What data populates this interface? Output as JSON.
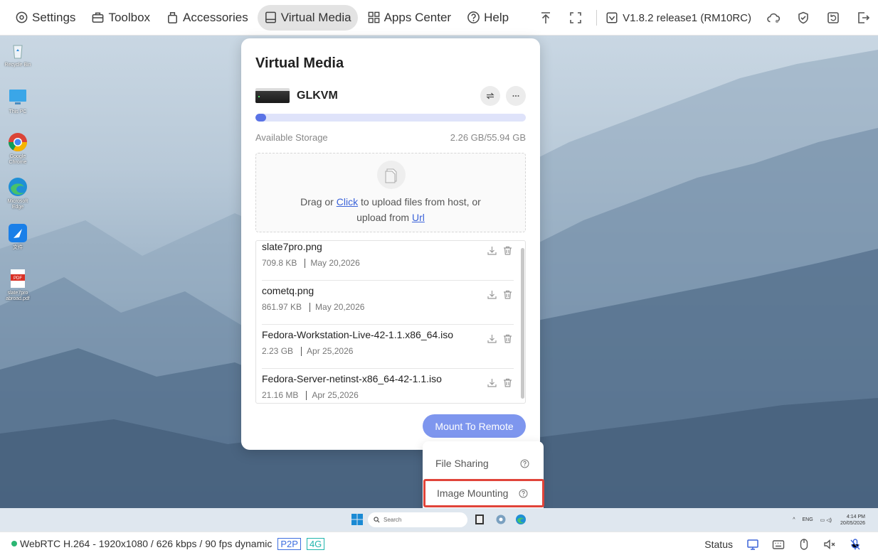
{
  "toolbar": {
    "nav": [
      {
        "label": "Settings",
        "icon": "settings-icon"
      },
      {
        "label": "Toolbox",
        "icon": "toolbox-icon"
      },
      {
        "label": "Accessories",
        "icon": "accessories-icon"
      },
      {
        "label": "Virtual Media",
        "icon": "drive-icon",
        "active": true
      },
      {
        "label": "Apps Center",
        "icon": "apps-icon"
      },
      {
        "label": "Help",
        "icon": "help-icon"
      }
    ],
    "version": "V1.8.2 release1 (RM10RC)"
  },
  "desktop": {
    "icons": [
      {
        "label": "Recycle Bin"
      },
      {
        "label": "This PC"
      },
      {
        "label": "Google Chrome"
      },
      {
        "label": "Microsoft Edge"
      },
      {
        "label": "文件"
      },
      {
        "label": "slate7pro abroad.pdf"
      }
    ]
  },
  "panel": {
    "title": "Virtual Media",
    "device_name": "GLKVM",
    "storage_label": "Available Storage",
    "storage_value": "2.26 GB/55.94 GB",
    "storage_fraction": 0.04,
    "upload_text_1": "Drag or ",
    "upload_link_click": "Click",
    "upload_text_2": " to upload files from host, or",
    "upload_text_3": "upload from ",
    "upload_link_url": "Url",
    "files": [
      {
        "name": "slate7pro.png",
        "size": "709.8 KB",
        "date": "May 20,2026"
      },
      {
        "name": "cometq.png",
        "size": "861.97 KB",
        "date": "May 20,2026"
      },
      {
        "name": "Fedora-Workstation-Live-42-1.1.x86_64.iso",
        "size": "2.23 GB",
        "date": "Apr 25,2026"
      },
      {
        "name": "Fedora-Server-netinst-x86_64-42-1.1.iso",
        "size": "21.16 MB",
        "date": "Apr 25,2026"
      }
    ],
    "mount_button": "Mount To Remote"
  },
  "dropdown": {
    "items": [
      {
        "label": "File Sharing"
      },
      {
        "label": "Image Mounting",
        "highlighted": true
      }
    ]
  },
  "taskbar": {
    "search_placeholder": "Search",
    "lang": "ENG",
    "time": "4:14 PM",
    "date": "20/05/2026"
  },
  "statusbar": {
    "stream_info": "WebRTC H.264 - 1920x1080 /  626 kbps / 90 fps dynamic",
    "badge_p2p": "P2P",
    "badge_4g": "4G",
    "status_label": "Status"
  },
  "colors": {
    "accent": "#5a73e6",
    "mount_button": "#7e96ee",
    "highlight_border": "#e0443a",
    "status_dot": "#2bb673"
  }
}
